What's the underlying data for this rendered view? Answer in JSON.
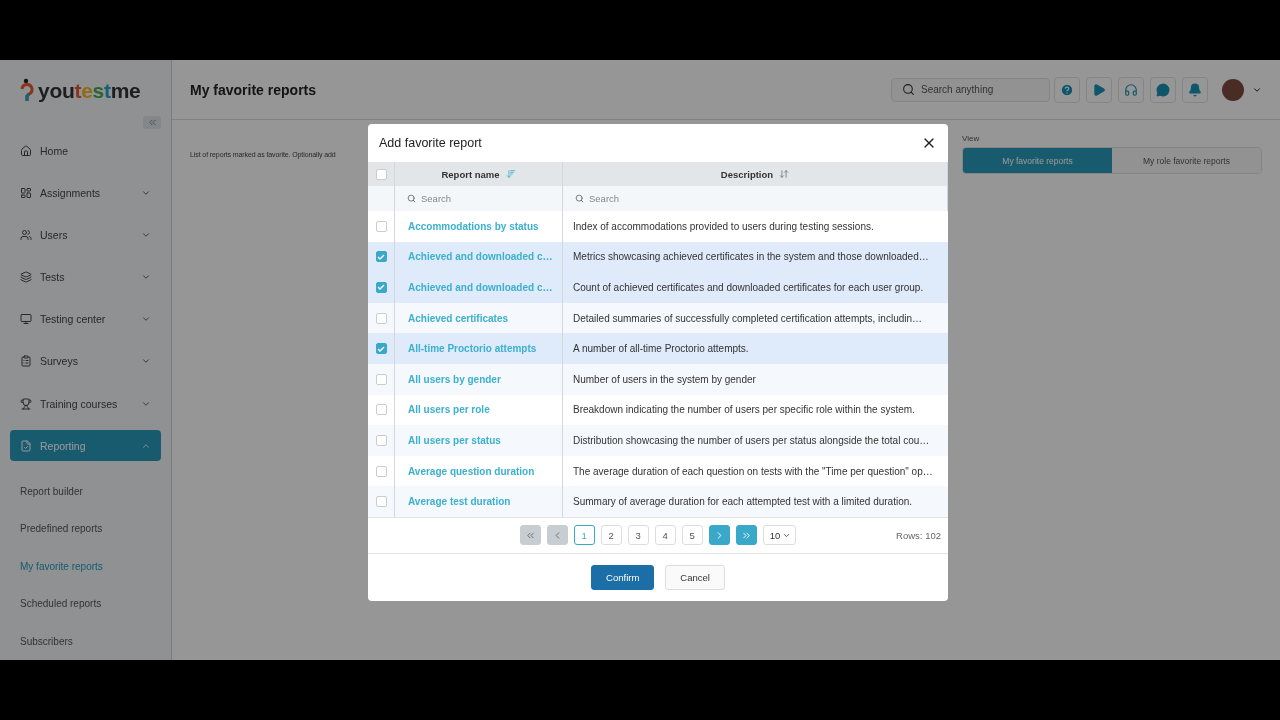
{
  "logo": {
    "text": "youtestme"
  },
  "sidebar": {
    "items": [
      {
        "label": "Home",
        "kind": "link"
      },
      {
        "label": "Assignments",
        "kind": "group",
        "expanded": false,
        "selected": false
      },
      {
        "label": "Users",
        "kind": "group",
        "expanded": false,
        "selected": false
      },
      {
        "label": "Tests",
        "kind": "group",
        "expanded": false,
        "selected": false
      },
      {
        "label": "Testing center",
        "kind": "group",
        "expanded": false,
        "selected": false
      },
      {
        "label": "Surveys",
        "kind": "group",
        "expanded": false,
        "selected": false
      },
      {
        "label": "Training courses",
        "kind": "group",
        "expanded": false,
        "selected": false
      },
      {
        "label": "Reporting",
        "kind": "group",
        "expanded": true,
        "selected": true,
        "children": [
          {
            "label": "Report builder",
            "selected": false
          },
          {
            "label": "Predefined reports",
            "selected": false
          },
          {
            "label": "My favorite reports",
            "selected": true
          },
          {
            "label": "Scheduled reports",
            "selected": false
          },
          {
            "label": "Subscribers",
            "selected": false
          }
        ]
      }
    ]
  },
  "header": {
    "title": "My favorite reports",
    "search": {
      "placeholder": "Search anything"
    }
  },
  "page": {
    "description": "List of reports marked as favorite. Optionally add",
    "view": {
      "label": "View",
      "options": [
        {
          "label": "My favorite reports",
          "selected": true
        },
        {
          "label": "My role favorite reports",
          "selected": false
        }
      ]
    }
  },
  "dialog": {
    "title": "Add favorite report",
    "table": {
      "all_checked": false,
      "columns": [
        {
          "label": "Report name",
          "sorted": true,
          "search_placeholder": "Search"
        },
        {
          "label": "Description",
          "sorted": false,
          "search_placeholder": "Search"
        }
      ],
      "rows": [
        {
          "name": "Accommodations by status",
          "description": "Index of accommodations provided to users during testing sessions.",
          "checked": false
        },
        {
          "name": "Achieved and downloaded c…",
          "description": "Metrics showcasing achieved certificates in the system and those downloaded…",
          "checked": true
        },
        {
          "name": "Achieved and downloaded c…",
          "description": "Count of achieved certificates and downloaded certificates for each user group.",
          "checked": true
        },
        {
          "name": "Achieved certificates",
          "description": "Detailed summaries of successfully completed certification attempts, includin…",
          "checked": false
        },
        {
          "name": "All-time Proctorio attempts",
          "description": "A number of all-time Proctorio attempts.",
          "checked": true
        },
        {
          "name": "All users by gender",
          "description": "Number of users in the system by gender",
          "checked": false
        },
        {
          "name": "All users per role",
          "description": "Breakdown indicating the number of users per specific role within the system.",
          "checked": false
        },
        {
          "name": "All users per status",
          "description": "Distribution showcasing the number of users per status alongside the total cou…",
          "checked": false
        },
        {
          "name": "Average question duration",
          "description": "The average duration of each question on tests with the \"Time per question\" op…",
          "checked": false
        },
        {
          "name": "Average test duration",
          "description": "Summary of average duration for each attempted test with a limited duration.",
          "checked": false
        }
      ]
    },
    "pagination": {
      "first_disabled": true,
      "prev_disabled": true,
      "pages": [
        {
          "label": "1",
          "selected": true
        },
        {
          "label": "2",
          "selected": false
        },
        {
          "label": "3",
          "selected": false
        },
        {
          "label": "4",
          "selected": false
        },
        {
          "label": "5",
          "selected": false
        }
      ],
      "next_disabled": false,
      "last_disabled": false,
      "page_size": "10",
      "rows": "Rows: 102"
    },
    "buttons": [
      {
        "label": "Confirm",
        "kind": "primary"
      },
      {
        "label": "Cancel",
        "kind": "secondary"
      }
    ]
  }
}
